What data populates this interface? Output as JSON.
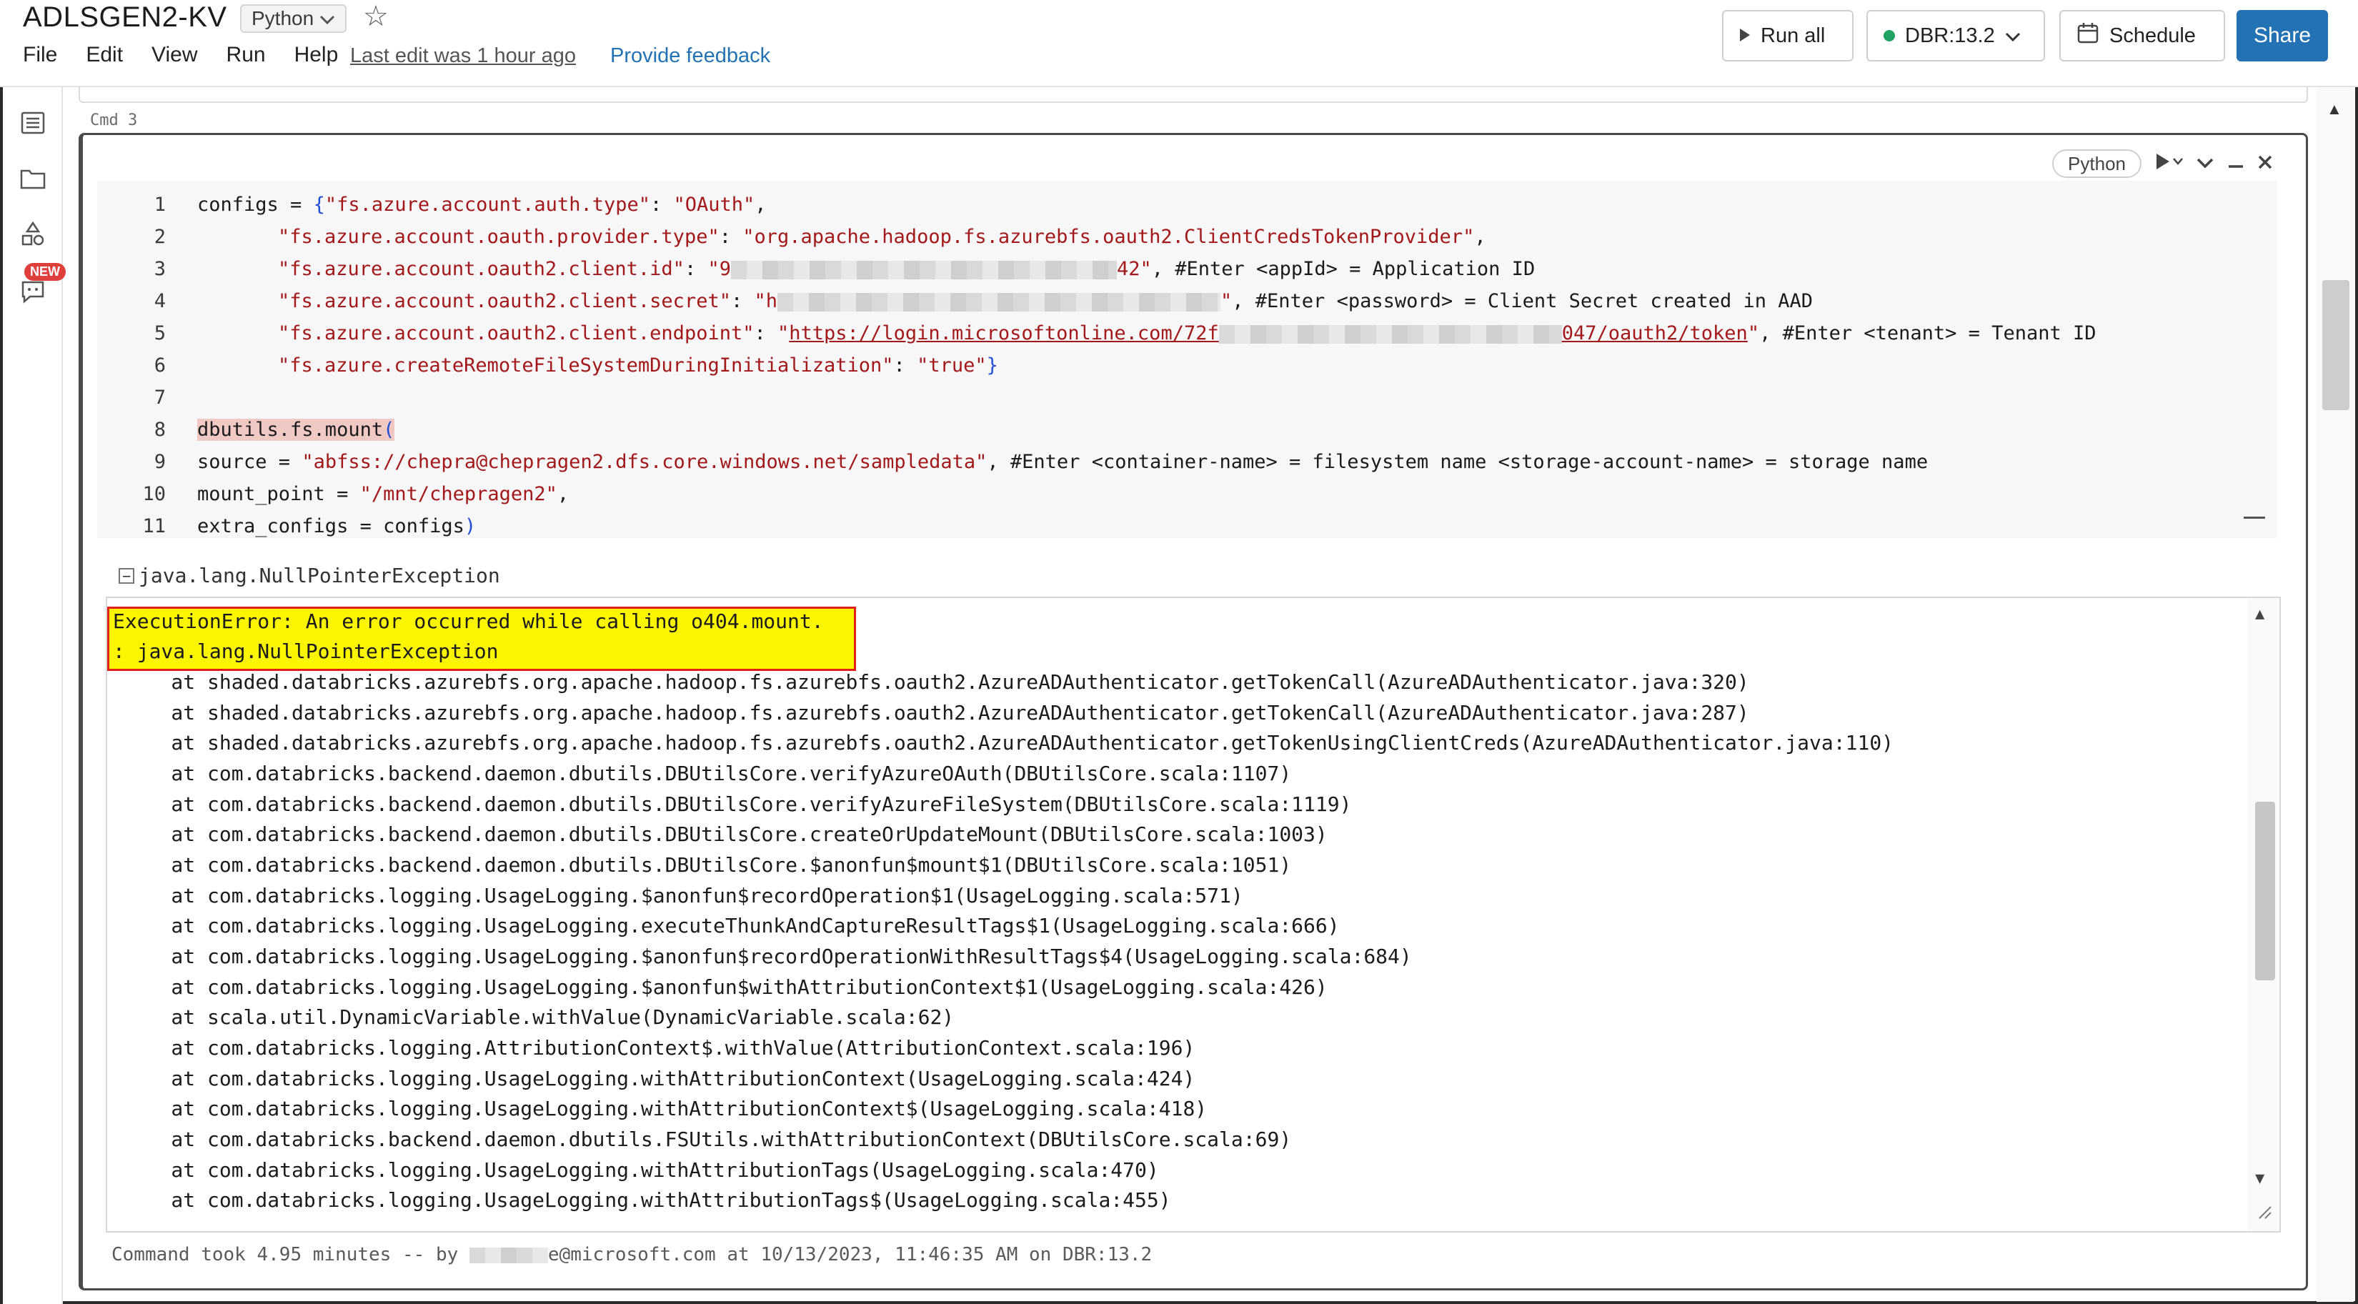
{
  "header": {
    "title": "ADLSGEN2-KV",
    "language": "Python",
    "menu": [
      "File",
      "Edit",
      "View",
      "Run",
      "Help"
    ],
    "last_edit": "Last edit was 1 hour ago",
    "feedback": "Provide feedback",
    "run_all": "Run all",
    "cluster": "DBR:13.2",
    "schedule": "Schedule",
    "share": "Share",
    "accent": "#2272b4",
    "cluster_status_color": "#21a366"
  },
  "sidebar": {
    "icons": [
      "table-of-contents-icon",
      "folder-icon",
      "shapes-icon",
      "assistant-chat-icon"
    ],
    "new_badge": "NEW"
  },
  "cell": {
    "cmd_label": "Cmd 3",
    "language": "Python",
    "code_lines": [
      {
        "n": "1"
      },
      {
        "n": "2"
      },
      {
        "n": "3"
      },
      {
        "n": "4"
      },
      {
        "n": "5"
      },
      {
        "n": "6"
      },
      {
        "n": "7"
      },
      {
        "n": "8"
      },
      {
        "n": "9"
      },
      {
        "n": "10"
      },
      {
        "n": "11"
      }
    ],
    "code": {
      "l1_a": "configs = ",
      "l1_b": "{",
      "l1_c": "\"fs.azure.account.auth.type\"",
      "l1_d": ": ",
      "l1_e": "\"OAuth\"",
      "l1_f": ",",
      "l2_a": "\"fs.azure.account.oauth.provider.type\"",
      "l2_b": ": ",
      "l2_c": "\"org.apache.hadoop.fs.azurebfs.oauth2.ClientCredsTokenProvider\"",
      "l2_d": ",",
      "l3_a": "\"fs.azure.account.oauth2.client.id\"",
      "l3_b": ": ",
      "l3_c": "\"9",
      "l3_d": "42\"",
      "l3_e": ", #Enter <appId> = Application ID",
      "l4_a": "\"fs.azure.account.oauth2.client.secret\"",
      "l4_b": ": ",
      "l4_c": "\"h",
      "l4_d": "\"",
      "l4_e": ", #Enter <password> = Client Secret created in AAD",
      "l5_a": "\"fs.azure.account.oauth2.client.endpoint\"",
      "l5_b": ": ",
      "l5_c": "\"",
      "l5_d": "https://login.microsoftonline.com/72f",
      "l5_e": "047/oauth2/token",
      "l5_f": "\"",
      "l5_g": ", #Enter <tenant> = Tenant ID",
      "l6_a": "\"fs.azure.createRemoteFileSystemDuringInitialization\"",
      "l6_b": ": ",
      "l6_c": "\"true\"",
      "l6_d": "}",
      "l8_a": "dbutils.fs.mount",
      "l8_b": "(",
      "l9_a": "source = ",
      "l9_b": "\"abfss://chepra@chepragen2.dfs.core.windows.net/sampledata\"",
      "l9_c": ", #Enter <container-name> = filesystem name <storage-account-name> = storage name",
      "l10_a": "mount_point = ",
      "l10_b": "\"/mnt/chepragen2\"",
      "l10_c": ",",
      "l11_a": "extra_configs = configs",
      "l11_b": ")"
    },
    "exception_toggle": "java.lang.NullPointerException",
    "output": {
      "error_line1": "ExecutionError: An error occurred while calling o404.mount.",
      "error_line2": ": java.lang.NullPointerException",
      "stack": [
        "\tat shaded.databricks.azurebfs.org.apache.hadoop.fs.azurebfs.oauth2.AzureADAuthenticator.getTokenCall(AzureADAuthenticator.java:320)",
        "\tat shaded.databricks.azurebfs.org.apache.hadoop.fs.azurebfs.oauth2.AzureADAuthenticator.getTokenCall(AzureADAuthenticator.java:287)",
        "\tat shaded.databricks.azurebfs.org.apache.hadoop.fs.azurebfs.oauth2.AzureADAuthenticator.getTokenUsingClientCreds(AzureADAuthenticator.java:110)",
        "\tat com.databricks.backend.daemon.dbutils.DBUtilsCore.verifyAzureOAuth(DBUtilsCore.scala:1107)",
        "\tat com.databricks.backend.daemon.dbutils.DBUtilsCore.verifyAzureFileSystem(DBUtilsCore.scala:1119)",
        "\tat com.databricks.backend.daemon.dbutils.DBUtilsCore.createOrUpdateMount(DBUtilsCore.scala:1003)",
        "\tat com.databricks.backend.daemon.dbutils.DBUtilsCore.$anonfun$mount$1(DBUtilsCore.scala:1051)",
        "\tat com.databricks.logging.UsageLogging.$anonfun$recordOperation$1(UsageLogging.scala:571)",
        "\tat com.databricks.logging.UsageLogging.executeThunkAndCaptureResultTags$1(UsageLogging.scala:666)",
        "\tat com.databricks.logging.UsageLogging.$anonfun$recordOperationWithResultTags$4(UsageLogging.scala:684)",
        "\tat com.databricks.logging.UsageLogging.$anonfun$withAttributionContext$1(UsageLogging.scala:426)",
        "\tat scala.util.DynamicVariable.withValue(DynamicVariable.scala:62)",
        "\tat com.databricks.logging.AttributionContext$.withValue(AttributionContext.scala:196)",
        "\tat com.databricks.logging.UsageLogging.withAttributionContext(UsageLogging.scala:424)",
        "\tat com.databricks.logging.UsageLogging.withAttributionContext$(UsageLogging.scala:418)",
        "\tat com.databricks.backend.daemon.dbutils.FSUtils.withAttributionContext(DBUtilsCore.scala:69)",
        "\tat com.databricks.logging.UsageLogging.withAttributionTags(UsageLogging.scala:470)",
        "\tat com.databricks.logging.UsageLogging.withAttributionTags$(UsageLogging.scala:455)"
      ]
    },
    "footer_prefix": "Command took 4.95 minutes -- by ",
    "footer_suffix": "e@microsoft.com at 10/13/2023, 11:46:35 AM on DBR:13.2"
  }
}
